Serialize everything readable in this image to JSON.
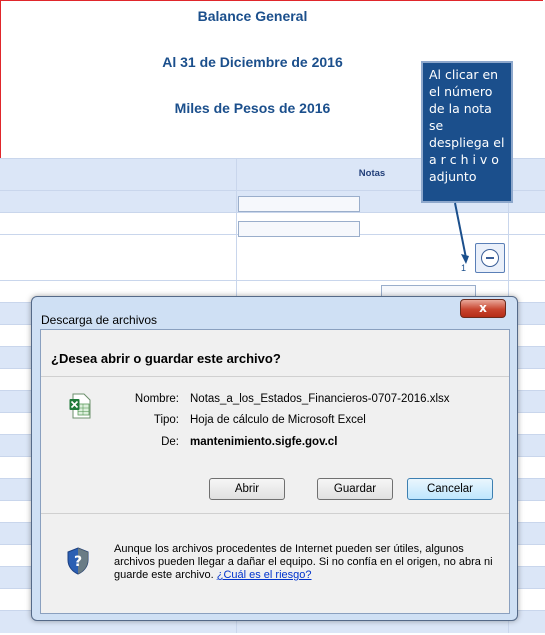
{
  "page": {
    "title": "Balance General",
    "date_line": "Al 31 de Diciembre de 2016",
    "units_line": "Miles de Pesos de 2016"
  },
  "callout": {
    "lines": [
      "Al clicar en",
      "el número",
      "de la nota se",
      "despliega el",
      "a r c h i v o",
      "adjunto"
    ]
  },
  "table": {
    "notas_header": "Notas",
    "note_number": "1"
  },
  "dialog": {
    "title": "Descarga de archivos",
    "close_glyph": "x",
    "question": "¿Desea abrir o guardar este archivo?",
    "file_icon": "excel-file-icon",
    "name_label": "Nombre:",
    "name_value": "Notas_a_los_Estados_Financieros-0707-2016.xlsx",
    "type_label": "Tipo:",
    "type_value": "Hoja de cálculo de Microsoft Excel",
    "from_label": "De:",
    "from_value": "mantenimiento.sigfe.gov.cl",
    "open_label": "Abrir",
    "save_label": "Guardar",
    "cancel_label": "Cancelar",
    "warning_text": "Aunque los archivos procedentes de Internet pueden ser útiles, algunos archivos pueden llegar a dañar el equipo. Si no confía en el origen, no abra ni guarde este archivo.",
    "risk_link": "¿Cuál es el riesgo?"
  },
  "colors": {
    "heading": "#1b4f8c",
    "callout_bg": "#1b4f8c",
    "frame_border": "#e0262b",
    "row_alt": "#dbe6f7",
    "dialog_frame": "#cfe0f4"
  }
}
